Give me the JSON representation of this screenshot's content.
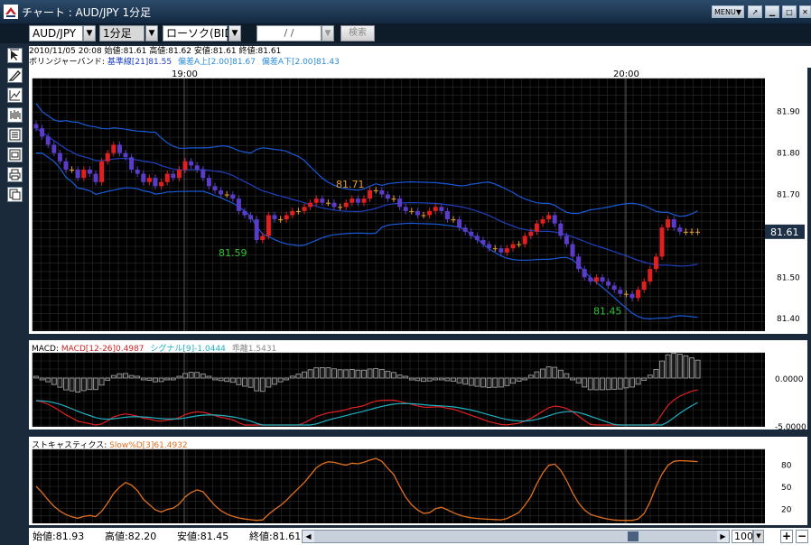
{
  "window": {
    "title": "チャート : AUD/JPY 1分足",
    "menu_label": "MENU▼"
  },
  "toolbar": {
    "symbol": "AUD/JPY",
    "timeframe": "1分足",
    "chart_type": "ローソク(BID)",
    "date_placeholder": "/ /",
    "search_label": "検索"
  },
  "info": {
    "ohlc_line": "2010/11/05 20:08 始値:81.61 高値:81.62 安値:81.61 終値:81.61",
    "bb_label": "ボリンジャーバンド:",
    "bb_base": "基準線[21]81.55",
    "bb_upper": "偏差A上[2.00]81.67",
    "bb_lower": "偏差A下[2.00]81.43"
  },
  "main_chart": {
    "time_labels": [
      "19:00",
      "20:00"
    ],
    "price_ticks": [
      "81.90",
      "81.80",
      "81.70",
      "81.60",
      "81.50",
      "81.40"
    ],
    "current_price": "81.61",
    "annotations": [
      "81.71",
      "81.59",
      "81.45"
    ],
    "colors": {
      "up": "#e02020",
      "down": "#5a3cc8",
      "doji": "#e8a030",
      "band": "#1a5ad8",
      "grid": "#2e2e2e",
      "bg": "#000000"
    }
  },
  "macd": {
    "label": "MACD:",
    "macd_text": "MACD[12-26]0.4987",
    "signal_text": "シグナル[9]-1.0444",
    "diff_text": "乖離1.5431",
    "ticks": [
      "0.0000",
      "-5.0000"
    ]
  },
  "stoch": {
    "label": "ストキャスティクス:",
    "value_text": "Slow%D[3]61.4932",
    "ticks": [
      "80",
      "50",
      "20"
    ]
  },
  "status": {
    "open": "始値:81.93",
    "high": "高値:82.20",
    "low": "安値:81.45",
    "close": "終値:81.61",
    "zoom": "100"
  },
  "chart_data": [
    {
      "type": "candlestick",
      "title": "AUD/JPY 1分足",
      "ylim": [
        81.37,
        81.98
      ],
      "y_ticks": [
        81.4,
        81.5,
        81.6,
        81.7,
        81.8,
        81.9
      ],
      "x_ticks": [
        "19:00",
        "20:00"
      ],
      "last": 81.61,
      "bollinger": {
        "period": 21,
        "deviation": 2.0,
        "base": 81.55,
        "upper": 81.67,
        "lower": 81.43
      },
      "closes": [
        81.86,
        81.84,
        81.82,
        81.8,
        81.78,
        81.76,
        81.76,
        81.74,
        81.76,
        81.75,
        81.73,
        81.78,
        81.8,
        81.82,
        81.8,
        81.79,
        81.76,
        81.75,
        81.73,
        81.74,
        81.72,
        81.73,
        81.75,
        81.74,
        81.76,
        81.78,
        81.77,
        81.76,
        81.74,
        81.72,
        81.71,
        81.7,
        81.7,
        81.69,
        81.66,
        81.65,
        81.64,
        81.59,
        81.6,
        81.65,
        81.64,
        81.64,
        81.65,
        81.66,
        81.66,
        81.67,
        81.68,
        81.69,
        81.68,
        81.68,
        81.67,
        81.67,
        81.68,
        81.69,
        81.68,
        81.69,
        81.71,
        81.71,
        81.7,
        81.69,
        81.69,
        81.67,
        81.66,
        81.66,
        81.65,
        81.65,
        81.66,
        81.67,
        81.66,
        81.64,
        81.64,
        81.62,
        81.61,
        81.6,
        81.59,
        81.58,
        81.57,
        81.57,
        81.56,
        81.57,
        81.58,
        81.58,
        81.6,
        81.61,
        81.63,
        81.64,
        81.65,
        81.63,
        81.6,
        81.58,
        81.55,
        81.52,
        81.5,
        81.49,
        81.5,
        81.49,
        81.48,
        81.47,
        81.46,
        81.46,
        81.45,
        81.47,
        81.49,
        81.52,
        81.55,
        81.62,
        81.64,
        81.62,
        81.61,
        81.61,
        81.61,
        81.61
      ],
      "annotations": [
        {
          "label": "81.71",
          "value": 81.71
        },
        {
          "label": "81.59",
          "value": 81.59
        },
        {
          "label": "81.45",
          "value": 81.45
        }
      ]
    },
    {
      "type": "line",
      "title": "MACD",
      "series": [
        {
          "name": "MACD[12-26]",
          "last": 0.4987
        },
        {
          "name": "シグナル[9]",
          "last": -1.0444
        },
        {
          "name": "乖離",
          "last": 1.5431
        }
      ],
      "y_ticks": [
        0.0,
        -5.0
      ]
    },
    {
      "type": "line",
      "title": "ストキャスティクス",
      "series": [
        {
          "name": "Slow%D[3]",
          "last": 61.4932
        }
      ],
      "ylim": [
        0,
        100
      ],
      "y_ticks": [
        80,
        50,
        20
      ]
    }
  ]
}
